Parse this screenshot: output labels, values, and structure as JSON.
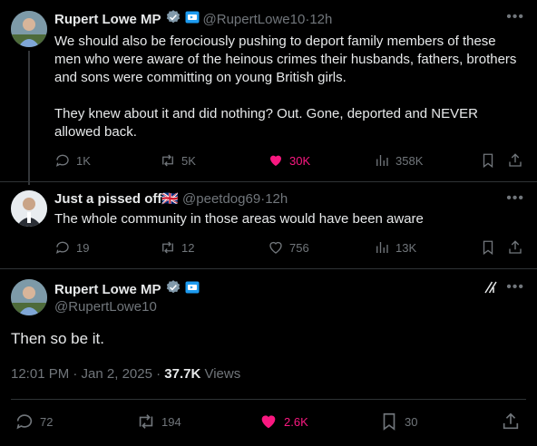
{
  "tweet1": {
    "name": "Rupert Lowe MP",
    "handle": "@RupertLowe10",
    "time": "12h",
    "text": "We should also be ferociously pushing to deport family members of these men who were aware of the heinous crimes their husbands, fathers, brothers and sons were committing on young British girls.\n\nThey knew about it and did nothing? Out. Gone, deported and NEVER allowed back.",
    "replies": "1K",
    "reposts": "5K",
    "likes": "30K",
    "views": "358K"
  },
  "tweet2": {
    "name": "Just a pissed off",
    "flag": "🇬🇧",
    "handle": "@peetdog69",
    "time": "12h",
    "text": "The whole community in those areas would have been aware",
    "replies": "19",
    "reposts": "12",
    "likes": "756",
    "views": "13K"
  },
  "tweet3": {
    "name": "Rupert Lowe MP",
    "handle": "@RupertLowe10",
    "text": "Then so be it.",
    "timestamp": "12:01 PM · Jan 2, 2025 · ",
    "views_count": "37.7K",
    "views_label": " Views",
    "replies": "72",
    "reposts": "194",
    "likes": "2.6K",
    "bookmarks": "30"
  },
  "separator": " · ",
  "colors": {
    "background": "#000000",
    "text": "#e7e9ea",
    "muted": "#71767b",
    "like": "#f91880",
    "verified_grey": "#829aab",
    "affiliate_blue": "#1d9bf0"
  },
  "icons": [
    "reply-icon",
    "repost-icon",
    "like-icon",
    "views-icon",
    "bookmark-icon",
    "share-icon",
    "more-icon",
    "grok-icon",
    "verified-badge",
    "affiliate-badge"
  ]
}
